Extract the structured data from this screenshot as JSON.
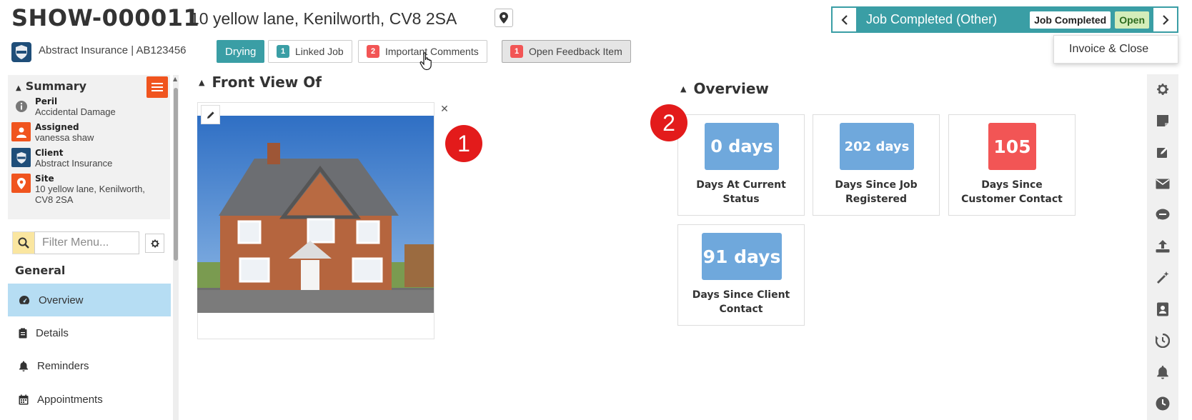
{
  "header": {
    "job_id": "SHOW-000011",
    "address": "10 yellow lane, Kenilworth, CV8 2SA",
    "client_ref": "Abstract Insurance | AB123456"
  },
  "tags": {
    "drying": "Drying",
    "linked_job": {
      "count": "1",
      "label": "Linked Job"
    },
    "important_comments": {
      "count": "2",
      "label": "Important Comments"
    },
    "open_feedback": {
      "count": "1",
      "label": "Open Feedback Item"
    }
  },
  "status": {
    "text": "Job Completed (Other)",
    "badge_completed": "Job Completed",
    "badge_open": "Open",
    "menu_item": "Invoice & Close"
  },
  "summary": {
    "title": "Summary",
    "items": [
      {
        "label": "Peril",
        "value": "Accidental Damage"
      },
      {
        "label": "Assigned",
        "value": "vanessa shaw"
      },
      {
        "label": "Client",
        "value": "Abstract Insurance"
      },
      {
        "label": "Site",
        "value": "10 yellow lane, Kenilworth, CV8 2SA"
      }
    ]
  },
  "filter": {
    "placeholder": "Filter Menu..."
  },
  "nav": {
    "heading": "General",
    "items": [
      {
        "label": "Overview",
        "active": true
      },
      {
        "label": "Details"
      },
      {
        "label": "Reminders"
      },
      {
        "label": "Appointments"
      }
    ]
  },
  "front_view": {
    "title": "Front View Of"
  },
  "overview": {
    "title": "Overview",
    "kpis": [
      {
        "value": "0 days",
        "label": "Days At Current Status",
        "color": "#6fa8dc"
      },
      {
        "value": "202 days",
        "label": "Days Since Job Registered",
        "color": "#6fa8dc"
      },
      {
        "value": "105",
        "label": "Days Since Customer Contact",
        "color": "#f25555"
      },
      {
        "value": "91 days",
        "label": "Days Since Client Contact",
        "color": "#6fa8dc"
      }
    ]
  },
  "markers": [
    "1",
    "2"
  ],
  "colors": {
    "teal": "#3a9ea5",
    "orange": "#f0541e",
    "red": "#e31b1b",
    "blue": "#6fa8dc"
  },
  "rail_icons": [
    "gear-icon",
    "note-icon",
    "edit-icon",
    "envelope-icon",
    "sms-icon",
    "upload-icon",
    "magic-wand-icon",
    "contact-book-icon",
    "history-icon",
    "bell-icon",
    "clock-icon"
  ]
}
